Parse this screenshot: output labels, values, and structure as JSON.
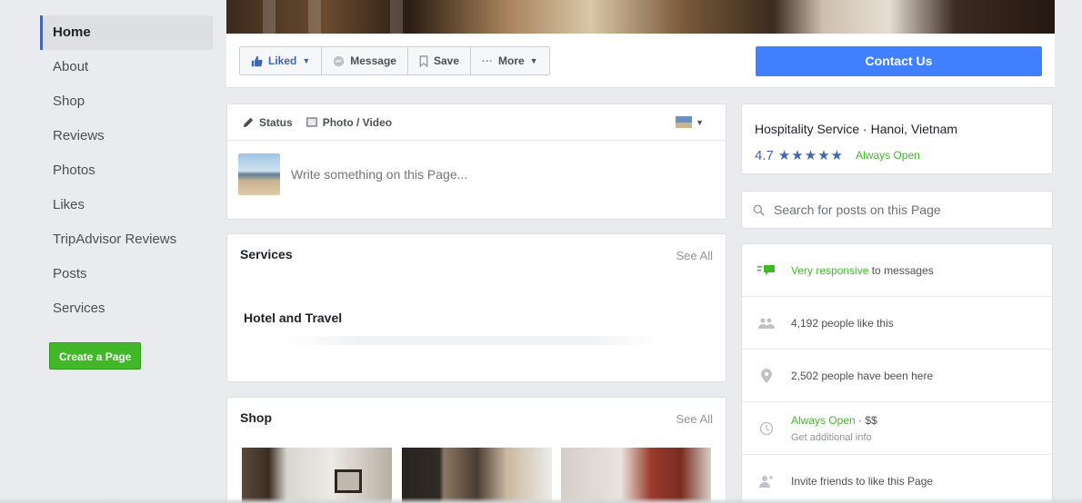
{
  "nav": {
    "items": [
      {
        "label": "Home",
        "active": true
      },
      {
        "label": "About"
      },
      {
        "label": "Shop"
      },
      {
        "label": "Reviews"
      },
      {
        "label": "Photos"
      },
      {
        "label": "Likes"
      },
      {
        "label": "TripAdvisor Reviews"
      },
      {
        "label": "Posts"
      },
      {
        "label": "Services"
      }
    ],
    "create_page_label": "Create a Page"
  },
  "actions": {
    "liked_label": "Liked",
    "message_label": "Message",
    "save_label": "Save",
    "more_label": "More",
    "contact_label": "Contact Us"
  },
  "composer": {
    "status_label": "Status",
    "photo_video_label": "Photo / Video",
    "placeholder": "Write something on this Page..."
  },
  "services": {
    "title": "Services",
    "see_all": "See All",
    "item": "Hotel and Travel"
  },
  "shop": {
    "title": "Shop",
    "see_all": "See All"
  },
  "info": {
    "category": "Hospitality Service · Hanoi, Vietnam",
    "rating": "4.7",
    "stars": "★★★★★",
    "open_status": "Always Open"
  },
  "search": {
    "placeholder": "Search for posts on this Page"
  },
  "about": {
    "responsive_highlight": "Very responsive",
    "responsive_rest": " to messages",
    "likes": "4,192 people like this",
    "checkins": "2,502 people have been here",
    "hours_open": "Always Open",
    "hours_price": " · $$",
    "hours_sub": "Get additional info",
    "invite": "Invite friends to like this Page"
  },
  "colors": {
    "fb_blue": "#4267b2",
    "contact_blue": "#4080ff",
    "green": "#42b72a",
    "background": "#e9ebee"
  }
}
